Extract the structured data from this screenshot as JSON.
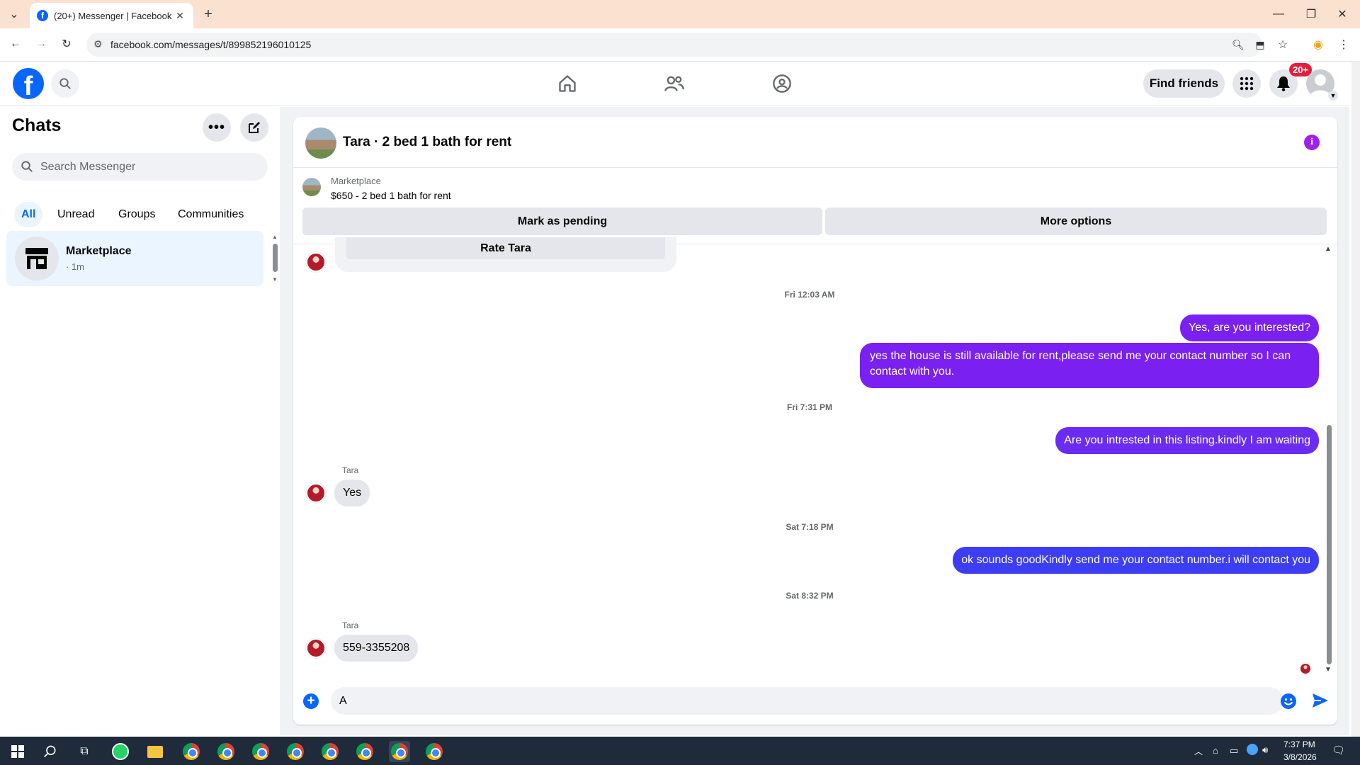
{
  "browser": {
    "tab_title": "(20+) Messenger | Facebook",
    "url": "facebook.com/messages/t/899852196010125"
  },
  "header": {
    "find_friends": "Find friends",
    "notifications_badge": "20+"
  },
  "sidebar": {
    "title": "Chats",
    "search_placeholder": "Search Messenger",
    "filters": [
      "All",
      "Unread",
      "Groups",
      "Communities"
    ],
    "active_filter": "All",
    "chats": [
      {
        "name": "Marketplace",
        "time": "· 1m"
      }
    ]
  },
  "conversation": {
    "title": "Tara · 2 bed 1 bath for rent",
    "marketplace_label": "Marketplace",
    "listing": "$650 - 2 bed 1 bath for rent",
    "mark_pending": "Mark as pending",
    "more_options": "More options",
    "rate_label": "Rate Tara",
    "messages": [
      {
        "type": "time",
        "text": "Fri 12:03 AM"
      },
      {
        "type": "out",
        "text": "Yes, are you interested?"
      },
      {
        "type": "out",
        "text": "yes the house is still available for rent,please send me your contact number so I can contact with you."
      },
      {
        "type": "time",
        "text": "Fri 7:31 PM"
      },
      {
        "type": "out",
        "text": "Are you intrested in this listing.kindly I am waiting"
      },
      {
        "type": "in",
        "sender": "Tara",
        "text": "Yes"
      },
      {
        "type": "time",
        "text": "Sat 7:18 PM"
      },
      {
        "type": "out",
        "text": "ok sounds goodKindly send me your contact number.i will contact you"
      },
      {
        "type": "time",
        "text": "Sat 8:32 PM"
      },
      {
        "type": "in",
        "sender": "Tara",
        "text": "559-3355208"
      }
    ],
    "composer_value": "A"
  },
  "taskbar": {
    "time": "7:37 PM",
    "date": "3/8/2026"
  },
  "colors": {
    "brand_blue": "#0866ff",
    "outgoing_bubble_purple": "#7a20f0",
    "outgoing_bubble_blue": "#3d3df5",
    "incoming_bubble": "#e4e6eb"
  }
}
